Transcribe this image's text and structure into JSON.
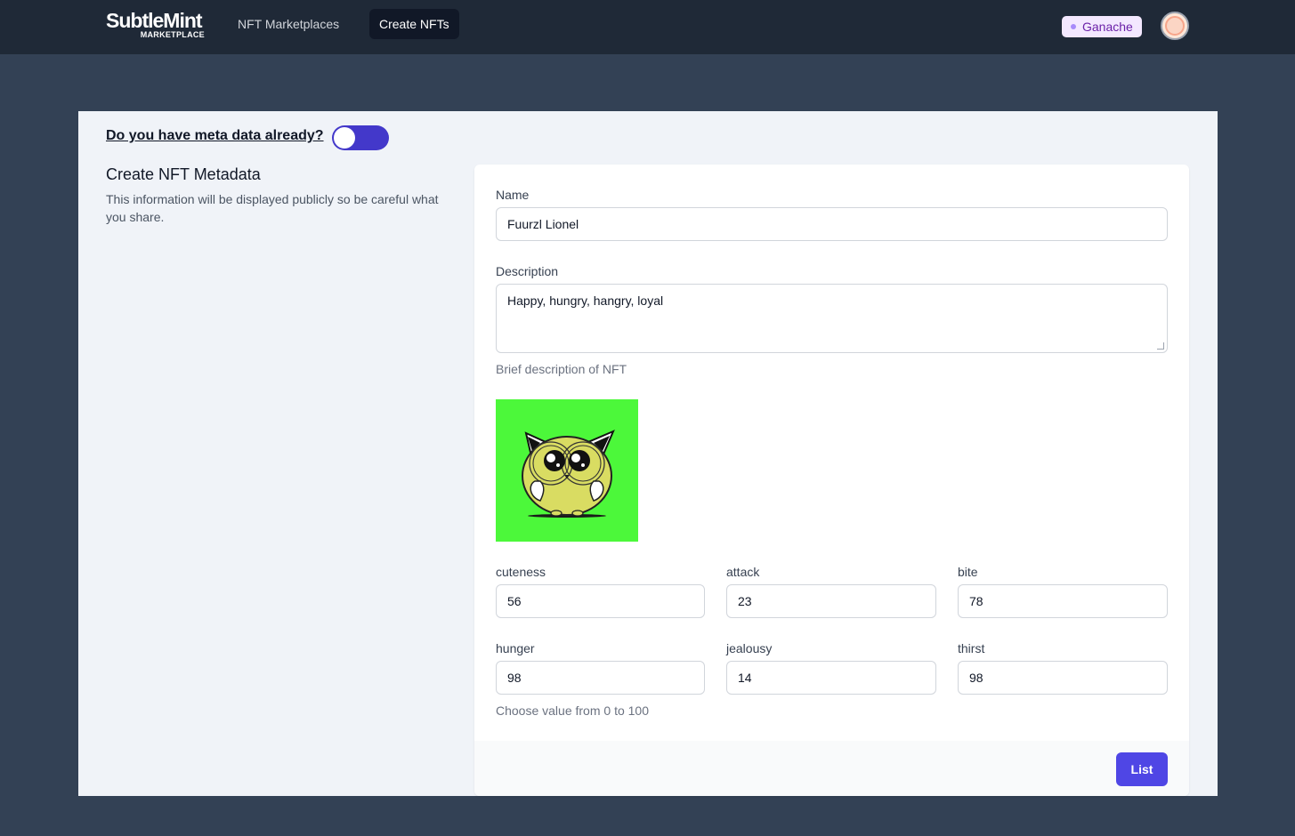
{
  "header": {
    "logo_main": "SubtleMint",
    "logo_sub": "MARKETPLACE",
    "nav": [
      {
        "label": "NFT Marketplaces",
        "active": false
      },
      {
        "label": "Create NFTs",
        "active": true
      }
    ],
    "network_badge": "Ganache",
    "avatar_icon": "user-avatar-icon"
  },
  "meta_toggle": {
    "label": "Do you have meta data already?",
    "checked": false
  },
  "section": {
    "title": "Create NFT Metadata",
    "description": "This information will be displayed publicly so be careful what you share."
  },
  "form": {
    "name_label": "Name",
    "name_value": "Fuurzl Lionel",
    "description_label": "Description",
    "description_value": "Happy, hungry, hangry, loyal",
    "description_help": "Brief description of NFT",
    "image_icon": "cat-nft-illustration",
    "attributes": [
      {
        "label": "cuteness",
        "value": "56"
      },
      {
        "label": "attack",
        "value": "23"
      },
      {
        "label": "bite",
        "value": "78"
      },
      {
        "label": "hunger",
        "value": "98"
      },
      {
        "label": "jealousy",
        "value": "14"
      },
      {
        "label": "thirst",
        "value": "98"
      }
    ],
    "attributes_help": "Choose value from 0 to 100",
    "submit_label": "List"
  },
  "colors": {
    "topbar": "#1f2937",
    "page_background": "#334155",
    "accent": "#4f46e5",
    "toggle": "#4338ca",
    "nft_background": "#4cf83a"
  }
}
